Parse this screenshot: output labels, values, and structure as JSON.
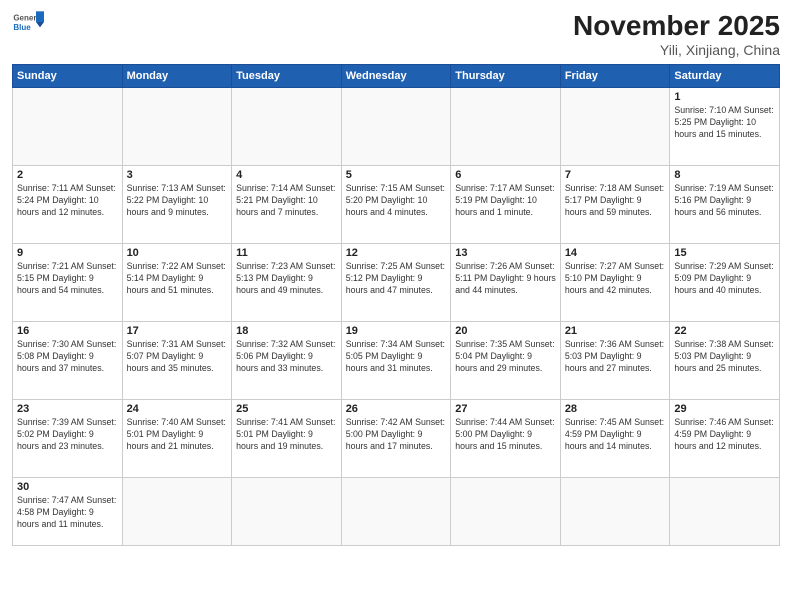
{
  "header": {
    "logo_general": "General",
    "logo_blue": "Blue",
    "month": "November 2025",
    "location": "Yili, Xinjiang, China"
  },
  "days_of_week": [
    "Sunday",
    "Monday",
    "Tuesday",
    "Wednesday",
    "Thursday",
    "Friday",
    "Saturday"
  ],
  "weeks": [
    [
      {
        "day": "",
        "info": ""
      },
      {
        "day": "",
        "info": ""
      },
      {
        "day": "",
        "info": ""
      },
      {
        "day": "",
        "info": ""
      },
      {
        "day": "",
        "info": ""
      },
      {
        "day": "",
        "info": ""
      },
      {
        "day": "1",
        "info": "Sunrise: 7:10 AM\nSunset: 5:25 PM\nDaylight: 10 hours\nand 15 minutes."
      }
    ],
    [
      {
        "day": "2",
        "info": "Sunrise: 7:11 AM\nSunset: 5:24 PM\nDaylight: 10 hours\nand 12 minutes."
      },
      {
        "day": "3",
        "info": "Sunrise: 7:13 AM\nSunset: 5:22 PM\nDaylight: 10 hours\nand 9 minutes."
      },
      {
        "day": "4",
        "info": "Sunrise: 7:14 AM\nSunset: 5:21 PM\nDaylight: 10 hours\nand 7 minutes."
      },
      {
        "day": "5",
        "info": "Sunrise: 7:15 AM\nSunset: 5:20 PM\nDaylight: 10 hours\nand 4 minutes."
      },
      {
        "day": "6",
        "info": "Sunrise: 7:17 AM\nSunset: 5:19 PM\nDaylight: 10 hours\nand 1 minute."
      },
      {
        "day": "7",
        "info": "Sunrise: 7:18 AM\nSunset: 5:17 PM\nDaylight: 9 hours\nand 59 minutes."
      },
      {
        "day": "8",
        "info": "Sunrise: 7:19 AM\nSunset: 5:16 PM\nDaylight: 9 hours\nand 56 minutes."
      }
    ],
    [
      {
        "day": "9",
        "info": "Sunrise: 7:21 AM\nSunset: 5:15 PM\nDaylight: 9 hours\nand 54 minutes."
      },
      {
        "day": "10",
        "info": "Sunrise: 7:22 AM\nSunset: 5:14 PM\nDaylight: 9 hours\nand 51 minutes."
      },
      {
        "day": "11",
        "info": "Sunrise: 7:23 AM\nSunset: 5:13 PM\nDaylight: 9 hours\nand 49 minutes."
      },
      {
        "day": "12",
        "info": "Sunrise: 7:25 AM\nSunset: 5:12 PM\nDaylight: 9 hours\nand 47 minutes."
      },
      {
        "day": "13",
        "info": "Sunrise: 7:26 AM\nSunset: 5:11 PM\nDaylight: 9 hours\nand 44 minutes."
      },
      {
        "day": "14",
        "info": "Sunrise: 7:27 AM\nSunset: 5:10 PM\nDaylight: 9 hours\nand 42 minutes."
      },
      {
        "day": "15",
        "info": "Sunrise: 7:29 AM\nSunset: 5:09 PM\nDaylight: 9 hours\nand 40 minutes."
      }
    ],
    [
      {
        "day": "16",
        "info": "Sunrise: 7:30 AM\nSunset: 5:08 PM\nDaylight: 9 hours\nand 37 minutes."
      },
      {
        "day": "17",
        "info": "Sunrise: 7:31 AM\nSunset: 5:07 PM\nDaylight: 9 hours\nand 35 minutes."
      },
      {
        "day": "18",
        "info": "Sunrise: 7:32 AM\nSunset: 5:06 PM\nDaylight: 9 hours\nand 33 minutes."
      },
      {
        "day": "19",
        "info": "Sunrise: 7:34 AM\nSunset: 5:05 PM\nDaylight: 9 hours\nand 31 minutes."
      },
      {
        "day": "20",
        "info": "Sunrise: 7:35 AM\nSunset: 5:04 PM\nDaylight: 9 hours\nand 29 minutes."
      },
      {
        "day": "21",
        "info": "Sunrise: 7:36 AM\nSunset: 5:03 PM\nDaylight: 9 hours\nand 27 minutes."
      },
      {
        "day": "22",
        "info": "Sunrise: 7:38 AM\nSunset: 5:03 PM\nDaylight: 9 hours\nand 25 minutes."
      }
    ],
    [
      {
        "day": "23",
        "info": "Sunrise: 7:39 AM\nSunset: 5:02 PM\nDaylight: 9 hours\nand 23 minutes."
      },
      {
        "day": "24",
        "info": "Sunrise: 7:40 AM\nSunset: 5:01 PM\nDaylight: 9 hours\nand 21 minutes."
      },
      {
        "day": "25",
        "info": "Sunrise: 7:41 AM\nSunset: 5:01 PM\nDaylight: 9 hours\nand 19 minutes."
      },
      {
        "day": "26",
        "info": "Sunrise: 7:42 AM\nSunset: 5:00 PM\nDaylight: 9 hours\nand 17 minutes."
      },
      {
        "day": "27",
        "info": "Sunrise: 7:44 AM\nSunset: 5:00 PM\nDaylight: 9 hours\nand 15 minutes."
      },
      {
        "day": "28",
        "info": "Sunrise: 7:45 AM\nSunset: 4:59 PM\nDaylight: 9 hours\nand 14 minutes."
      },
      {
        "day": "29",
        "info": "Sunrise: 7:46 AM\nSunset: 4:59 PM\nDaylight: 9 hours\nand 12 minutes."
      }
    ],
    [
      {
        "day": "30",
        "info": "Sunrise: 7:47 AM\nSunset: 4:58 PM\nDaylight: 9 hours\nand 11 minutes."
      },
      {
        "day": "",
        "info": ""
      },
      {
        "day": "",
        "info": ""
      },
      {
        "day": "",
        "info": ""
      },
      {
        "day": "",
        "info": ""
      },
      {
        "day": "",
        "info": ""
      },
      {
        "day": "",
        "info": ""
      }
    ]
  ]
}
